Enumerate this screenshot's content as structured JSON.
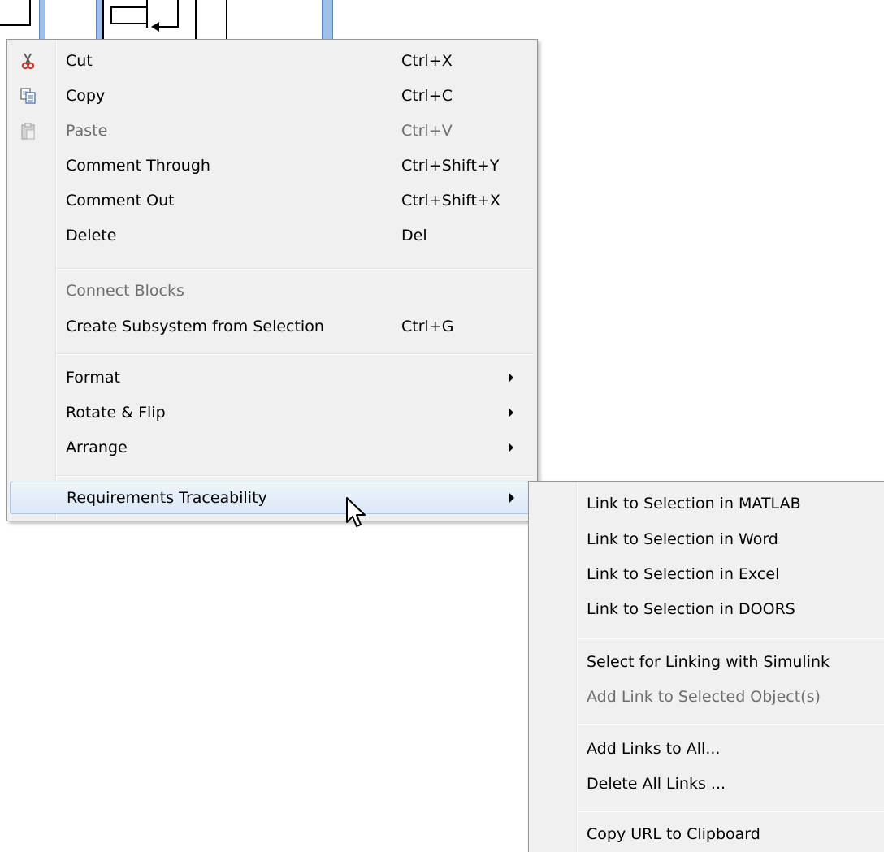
{
  "context_menu": {
    "items": [
      {
        "label": "Cut",
        "shortcut": "Ctrl+X",
        "icon": "scissors-icon",
        "enabled": true
      },
      {
        "label": "Copy",
        "shortcut": "Ctrl+C",
        "icon": "copy-icon",
        "enabled": true
      },
      {
        "label": "Paste",
        "shortcut": "Ctrl+V",
        "icon": "paste-icon",
        "enabled": false
      },
      {
        "label": "Comment Through",
        "shortcut": "Ctrl+Shift+Y",
        "enabled": true
      },
      {
        "label": "Comment Out",
        "shortcut": "Ctrl+Shift+X",
        "enabled": true
      },
      {
        "label": "Delete",
        "shortcut": "Del",
        "enabled": true
      },
      {
        "label": "Connect Blocks",
        "shortcut": "",
        "enabled": false
      },
      {
        "label": "Create Subsystem from Selection",
        "shortcut": "Ctrl+G",
        "enabled": true
      },
      {
        "label": "Format",
        "submenu": true,
        "enabled": true
      },
      {
        "label": "Rotate & Flip",
        "submenu": true,
        "enabled": true
      },
      {
        "label": "Arrange",
        "submenu": true,
        "enabled": true
      },
      {
        "label": "Requirements Traceability",
        "submenu": true,
        "enabled": true,
        "highlighted": true
      }
    ]
  },
  "submenu": {
    "items": [
      {
        "label": "Link to Selection in MATLAB",
        "enabled": true
      },
      {
        "label": "Link to Selection in Word",
        "enabled": true
      },
      {
        "label": "Link to Selection in Excel",
        "enabled": true
      },
      {
        "label": "Link to Selection in DOORS",
        "enabled": true
      },
      {
        "label": "Select for Linking with Simulink",
        "enabled": true
      },
      {
        "label": "Add Link to Selected Object(s)",
        "enabled": false
      },
      {
        "label": "Add Links to All...",
        "enabled": true
      },
      {
        "label": "Delete All Links ...",
        "enabled": true
      },
      {
        "label": "Copy URL to Clipboard",
        "enabled": true
      }
    ]
  },
  "colors": {
    "menu_background": "#f0f0f0",
    "disabled_text": "#6d6d6d",
    "highlight_border": "#a9c7ec",
    "selection_bar": "#9fc1e8"
  }
}
